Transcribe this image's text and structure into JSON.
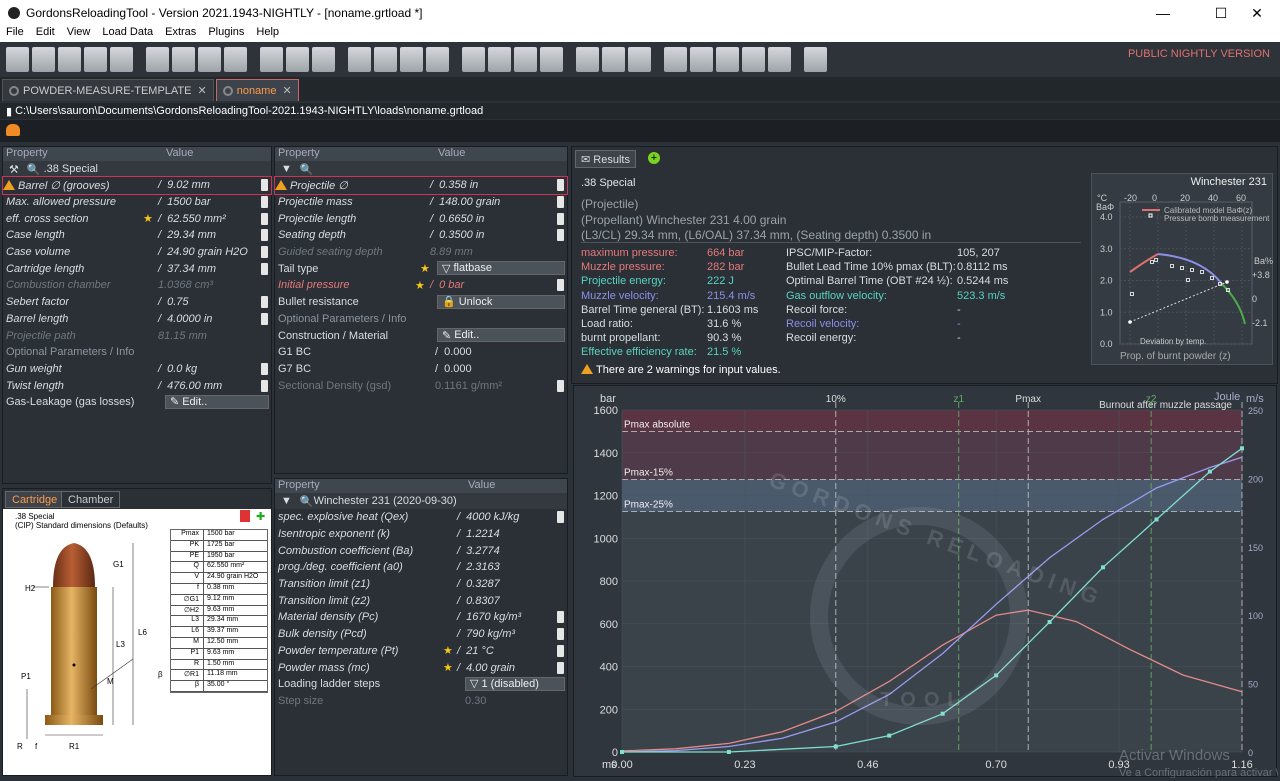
{
  "window": {
    "title": "GordonsReloadingTool - Version 2021.1943-NIGHTLY - [noname.grtload *]"
  },
  "menu": [
    "File",
    "Edit",
    "View",
    "Load Data",
    "Extras",
    "Plugins",
    "Help"
  ],
  "banner": "PUBLIC NIGHTLY VERSION",
  "tabs": [
    {
      "label": "POWDER-MEASURE-TEMPLATE"
    },
    {
      "label": "noname"
    }
  ],
  "path": "C:\\Users\\sauron\\Documents\\GordonsReloadingTool-2021.1943-NIGHTLY\\loads\\noname.grtload",
  "headers": {
    "property": "Property",
    "value": "Value"
  },
  "cartridge": {
    "selector": ".38 Special",
    "rows": [
      {
        "n": "Barrel ∅ (grooves)",
        "v": "9.02 mm"
      },
      {
        "n": "Max. allowed pressure",
        "v": "1500 bar"
      },
      {
        "n": "eff. cross section",
        "v": "62.550 mm²"
      },
      {
        "n": "Case length",
        "v": "29.34 mm"
      },
      {
        "n": "Case volume",
        "v": "24.90 grain H2O"
      },
      {
        "n": "Cartridge length",
        "v": "37.34 mm"
      },
      {
        "n": "Combustion chamber",
        "v": "1.0368 cm³"
      },
      {
        "n": "Sebert factor",
        "v": "0.75"
      },
      {
        "n": "Barrel length",
        "v": "4.0000 in"
      },
      {
        "n": "Projectile path",
        "v": "81.15 mm"
      }
    ],
    "optional": "Optional Parameters / Info",
    "opt_rows": [
      {
        "n": "Gun weight",
        "v": "0.0 kg"
      },
      {
        "n": "Twist length",
        "v": "476.00 mm"
      },
      {
        "n": "Gas-Leakage (gas losses)",
        "v": "Edit.."
      }
    ]
  },
  "projectile": {
    "rows": [
      {
        "n": "Projectile ∅",
        "v": "0.358 in"
      },
      {
        "n": "Projectile mass",
        "v": "148.00 grain"
      },
      {
        "n": "Projectile length",
        "v": "0.6650 in"
      },
      {
        "n": "Seating depth",
        "v": "0.3500 in"
      },
      {
        "n": "Guided seating depth",
        "v": "8.89 mm"
      },
      {
        "n": "Tail type",
        "v": "flatbase"
      },
      {
        "n": "Initial pressure",
        "v": "0 bar"
      },
      {
        "n": "Bullet resistance",
        "v": "Unlock"
      }
    ],
    "optional": "Optional Parameters / Info",
    "opt_rows": [
      {
        "n": "Construction / Material",
        "v": "Edit.."
      },
      {
        "n": "G1 BC",
        "v": "0.000"
      },
      {
        "n": "G7 BC",
        "v": "0.000"
      },
      {
        "n": "Sectional Density (gsd)",
        "v": "0.1161 g/mm²"
      }
    ]
  },
  "powder": {
    "selector": "Winchester 231 (2020-09-30)",
    "rows": [
      {
        "n": "spec. explosive heat (Qex)",
        "v": "4000 kJ/kg"
      },
      {
        "n": "Isentropic exponent (k)",
        "v": "1.2214"
      },
      {
        "n": "Combustion coefficient (Ba)",
        "v": "3.2774"
      },
      {
        "n": "prog./deg. coefficient (a0)",
        "v": "2.3163"
      },
      {
        "n": "Transition limit (z1)",
        "v": "0.3287"
      },
      {
        "n": "Transition limit (z2)",
        "v": "0.8307"
      },
      {
        "n": "Material density (Pc)",
        "v": "1670 kg/m³"
      },
      {
        "n": "Bulk density (Pcd)",
        "v": "790 kg/m³"
      },
      {
        "n": "Powder temperature (Pt)",
        "v": "21 °C"
      },
      {
        "n": "Powder mass (mc)",
        "v": "4.00 grain"
      },
      {
        "n": "Loading ladder steps",
        "v": "1 (disabled)"
      },
      {
        "n": "Step size",
        "v": "0.30"
      }
    ]
  },
  "cartridge_tabs": [
    "Cartridge",
    "Chamber"
  ],
  "drawing": {
    "title": ".38 Special",
    "subtitle": "(CIP) Standard dimensions (Defaults)",
    "table": [
      [
        "Pmax",
        "1500 bar"
      ],
      [
        "PK",
        "1725 bar"
      ],
      [
        "PE",
        "1950 bar"
      ],
      [
        "Q",
        "62.550 mm²"
      ],
      [
        "V",
        "24.90 grain H2O"
      ],
      [
        "f",
        "0.38 mm"
      ],
      [
        "∅G1",
        "9.12 mm"
      ],
      [
        "∅H2",
        "9.63 mm"
      ],
      [
        "L3",
        "29.34 mm"
      ],
      [
        "L6",
        "39.37 mm"
      ],
      [
        "M",
        "12.50 mm"
      ],
      [
        "P1",
        "9.63 mm"
      ],
      [
        "R",
        "1.50 mm"
      ],
      [
        "∅R1",
        "11.18 mm"
      ],
      [
        "β",
        "35.00 °"
      ]
    ],
    "labels": [
      "G1",
      "H2",
      "L6",
      "L3",
      "M",
      "P1",
      "R",
      "f",
      "R1",
      "β"
    ]
  },
  "results": {
    "tab": "Results",
    "title": ".38 Special",
    "lines": [
      "(Projectile)",
      "(Propellant) Winchester 231 4.00 grain",
      "(L3/CL) 29.34 mm, (L6/OAL) 37.34 mm, (Seating depth) 0.3500 in"
    ],
    "left": [
      {
        "k": "maximum pressure:",
        "v": "664 bar",
        "c": "red"
      },
      {
        "k": "Muzzle pressure:",
        "v": "282 bar",
        "c": "red"
      },
      {
        "k": "Projectile energy:",
        "v": "222 J",
        "c": "cyan"
      },
      {
        "k": "Muzzle velocity:",
        "v": "215.4 m/s",
        "c": "blu"
      },
      {
        "k": "Barrel Time general (BT):",
        "v": "1.1603 ms",
        "c": ""
      },
      {
        "k": "Load ratio:",
        "v": "31.6 %",
        "c": ""
      },
      {
        "k": "burnt propellant:",
        "v": "90.3 %",
        "c": ""
      },
      {
        "k": "Effective efficiency rate:",
        "v": "21.5 %",
        "c": "cyan"
      }
    ],
    "right": [
      {
        "k": "IPSC/MIP-Factor:",
        "v": "105, 207",
        "c": ""
      },
      {
        "k": "Bullet Lead Time 10% pmax (BLT):",
        "v": "0.8112 ms",
        "c": ""
      },
      {
        "k": "Optimal Barrel Time (OBT #24 ½):",
        "v": "0.5244 ms",
        "c": ""
      },
      {
        "k": "Gas outflow velocity:",
        "v": "523.3 m/s",
        "c": "cyan"
      },
      {
        "k": "Recoil force:",
        "v": "-",
        "c": ""
      },
      {
        "k": "Recoil velocity:",
        "v": "-",
        "c": "blu"
      },
      {
        "k": "Recoil energy:",
        "v": "-",
        "c": ""
      }
    ],
    "warning": "There are 2 warnings for input values."
  },
  "mini": {
    "title": "Winchester 231",
    "legend": [
      "Calibrated model BaΦ(z)",
      "Pressure bomb measurement"
    ],
    "xlabel": "Prop. of burnt powder (z)",
    "top_label": "°C",
    "ylabel": "BaΦ",
    "right_label": "Ba%",
    "deviation": "Deviation by temp.",
    "xticks": [
      "-20",
      "0",
      "20",
      "40",
      "60"
    ],
    "yticks": [
      "4.0",
      "3.0",
      "2.0",
      "1.0",
      "0.0"
    ],
    "rticks": [
      "+3.8",
      "0",
      "-2.1"
    ]
  },
  "chart_data": {
    "type": "line",
    "xlabel": "ms",
    "ylabel_left": "bar",
    "ylabel_right": "m/s",
    "ylabel_right2": "Joule",
    "x_ticks": [
      "0.00",
      "0.23",
      "0.46",
      "0.70",
      "0.93",
      "1.16"
    ],
    "y_ticks": [
      "0",
      "200",
      "400",
      "600",
      "800",
      "1000",
      "1200",
      "1400",
      "1600"
    ],
    "v_ticks": [
      "0",
      "50",
      "100",
      "150",
      "200",
      "250"
    ],
    "xlim": [
      0,
      1.16
    ],
    "ylim": [
      0,
      1600
    ],
    "bands": [
      {
        "name": "Pmax absolute",
        "value": 1500
      },
      {
        "name": "Pmax-15%",
        "value": 1275
      },
      {
        "name": "Pmax-25%",
        "value": 1125
      }
    ],
    "markers": [
      {
        "name": "10%",
        "x": 0.4
      },
      {
        "name": "z1",
        "x": 0.63
      },
      {
        "name": "Pmax",
        "x": 0.76
      },
      {
        "name": "z2",
        "x": 0.99
      },
      {
        "name": "Burnout after muzzle passage",
        "x": 1.16
      }
    ],
    "series": [
      {
        "name": "pressure",
        "x": [
          0,
          0.1,
          0.2,
          0.3,
          0.4,
          0.5,
          0.6,
          0.7,
          0.76,
          0.85,
          0.95,
          1.05,
          1.16
        ],
        "y": [
          5,
          15,
          40,
          95,
          190,
          330,
          500,
          640,
          664,
          610,
          480,
          360,
          282
        ]
      },
      {
        "name": "velocity",
        "x": [
          0,
          0.1,
          0.2,
          0.3,
          0.4,
          0.5,
          0.6,
          0.7,
          0.8,
          0.9,
          1.0,
          1.1,
          1.16
        ],
        "y": [
          0,
          1,
          4,
          10,
          22,
          42,
          72,
          108,
          142,
          170,
          193,
          208,
          215.4
        ]
      },
      {
        "name": "energy",
        "x": [
          0,
          0.2,
          0.4,
          0.5,
          0.6,
          0.7,
          0.8,
          0.9,
          1.0,
          1.1,
          1.16
        ],
        "y": [
          0,
          0,
          4,
          12,
          28,
          56,
          95,
          135,
          170,
          205,
          222
        ]
      }
    ]
  },
  "watermark": {
    "text": "GORDONS RELOADING",
    "bottom": "TOOL"
  },
  "activate": {
    "l1": "Activar Windows",
    "l2": "Ve a Configuración para activar Windows."
  }
}
